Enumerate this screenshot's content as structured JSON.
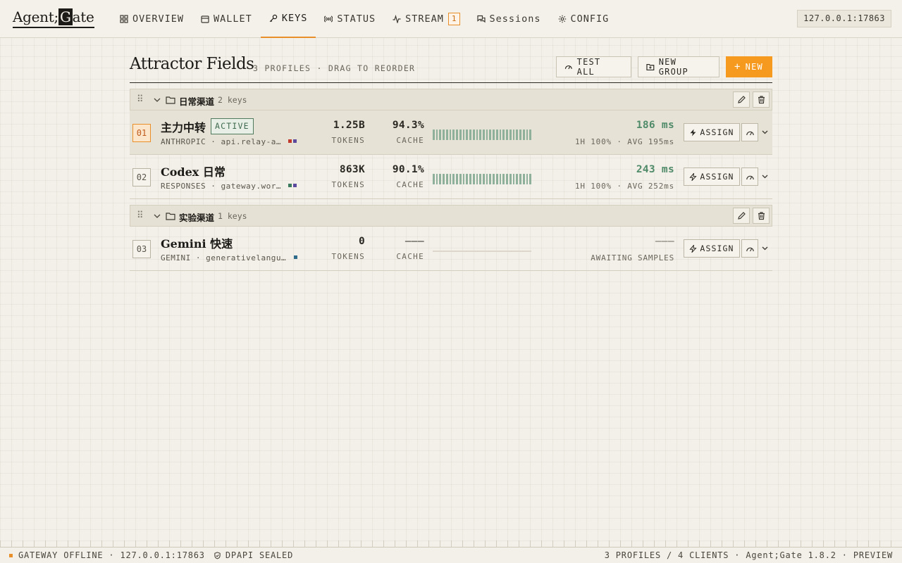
{
  "app": {
    "logo_left": "Agent;",
    "logo_g": "G",
    "logo_right": "ate",
    "address": "127.0.0.1:17863"
  },
  "nav": [
    {
      "label": "OVERVIEW",
      "icon": "grid-icon",
      "active": false
    },
    {
      "label": "WALLET",
      "icon": "wallet-icon",
      "active": false
    },
    {
      "label": "KEYS",
      "icon": "key-icon",
      "active": true
    },
    {
      "label": "STATUS",
      "icon": "broadcast-icon",
      "active": false
    },
    {
      "label": "STREAM",
      "icon": "activity-icon",
      "active": false,
      "badge": "1"
    },
    {
      "label": "Sessions",
      "icon": "chat-icon",
      "active": false
    },
    {
      "label": "CONFIG",
      "icon": "gear-icon",
      "active": false
    }
  ],
  "page": {
    "title": "Attractor Fields",
    "subtitle": "3 PROFILES · DRAG TO REORDER",
    "test_all": "TEST ALL",
    "new_group": "NEW GROUP",
    "new": "NEW"
  },
  "groups": [
    {
      "name": "日常渠道",
      "count": "2 keys",
      "profiles": [
        {
          "index": "01",
          "name": "主力中转",
          "active": true,
          "active_label": "ACTIVE",
          "provider": "ANTHROPIC · api.relay-a…",
          "dot_colors": [
            "#c0392b",
            "#5b4a9e"
          ],
          "tokens": "1.25B",
          "tokens_label": "TOKENS",
          "cache": "94.3%",
          "cache_label": "CACHE",
          "samples": 30,
          "latency": "186 ms",
          "latency_sub": "1H 100% · AVG 195ms",
          "assign": "ASSIGN"
        },
        {
          "index": "02",
          "name": "Codex 日常",
          "active": false,
          "provider": "RESPONSES · gateway.wor…",
          "dot_colors": [
            "#3b7a5c",
            "#5b4a9e"
          ],
          "tokens": "863K",
          "tokens_label": "TOKENS",
          "cache": "90.1%",
          "cache_label": "CACHE",
          "samples": 30,
          "latency": "243 ms",
          "latency_sub": "1H 100% · AVG 252ms",
          "assign": "ASSIGN"
        }
      ]
    },
    {
      "name": "实验渠道",
      "count": "1 keys",
      "profiles": [
        {
          "index": "03",
          "name": "Gemini 快速",
          "active": false,
          "provider": "GEMINI · generativelangu…",
          "dot_colors": [
            "#2e6a8a"
          ],
          "tokens": "0",
          "tokens_label": "TOKENS",
          "cache": "———",
          "cache_label": "CACHE",
          "samples": 0,
          "latency": "———",
          "latency_sub": "AWAITING SAMPLES",
          "assign": "ASSIGN"
        }
      ]
    }
  ],
  "footer": {
    "status": "GATEWAY OFFLINE · 127.0.0.1:17863",
    "seal": "DPAPI SEALED",
    "right": "3 PROFILES / 4 CLIENTS · Agent;Gate 1.8.2 · PREVIEW"
  },
  "colors": {
    "accent": "#f59a1f",
    "success": "#4f8a69",
    "background": "#f3f0e9"
  }
}
